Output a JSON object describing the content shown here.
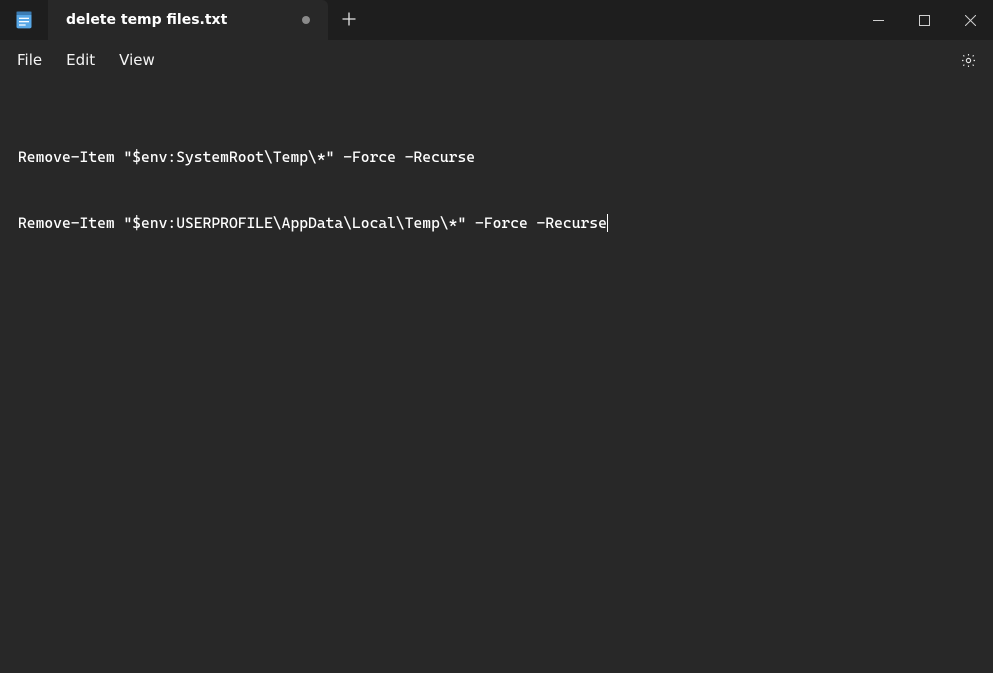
{
  "tab": {
    "title": "delete temp files.txt",
    "dirty": true
  },
  "menu": {
    "file": "File",
    "edit": "Edit",
    "view": "View"
  },
  "editor": {
    "line1": "Remove-Item \"$env:SystemRoot\\Temp\\*\" -Force -Recurse",
    "line2": "Remove-Item \"$env:USERPROFILE\\AppData\\Local\\Temp\\*\" -Force -Recurse"
  }
}
